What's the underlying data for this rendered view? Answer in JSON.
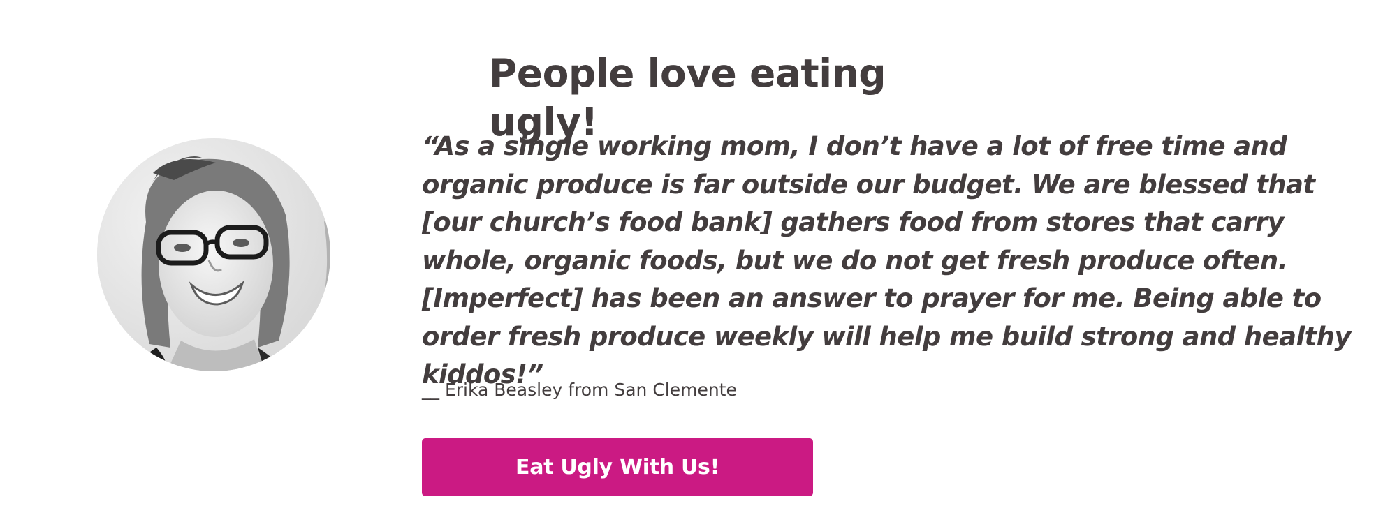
{
  "testimonial": {
    "heading": "People love eating ugly!",
    "quote": "“As a single working mom, I don’t have a lot of free time and organic produce is far outside our budget. We are blessed that [our church’s food bank] gathers food from stores that carry whole, organic foods, but we do not get fresh produce often. [Imperfect] has been an answer to prayer for me. Being able to order fresh produce weekly will help me build strong and healthy kiddos!”",
    "attribution": "__ Erika Beasley from San Clemente",
    "cta_label": "Eat Ugly With Us!"
  },
  "colors": {
    "accent": "#cb1a83",
    "text": "#433d3e",
    "background": "#ffffff"
  }
}
